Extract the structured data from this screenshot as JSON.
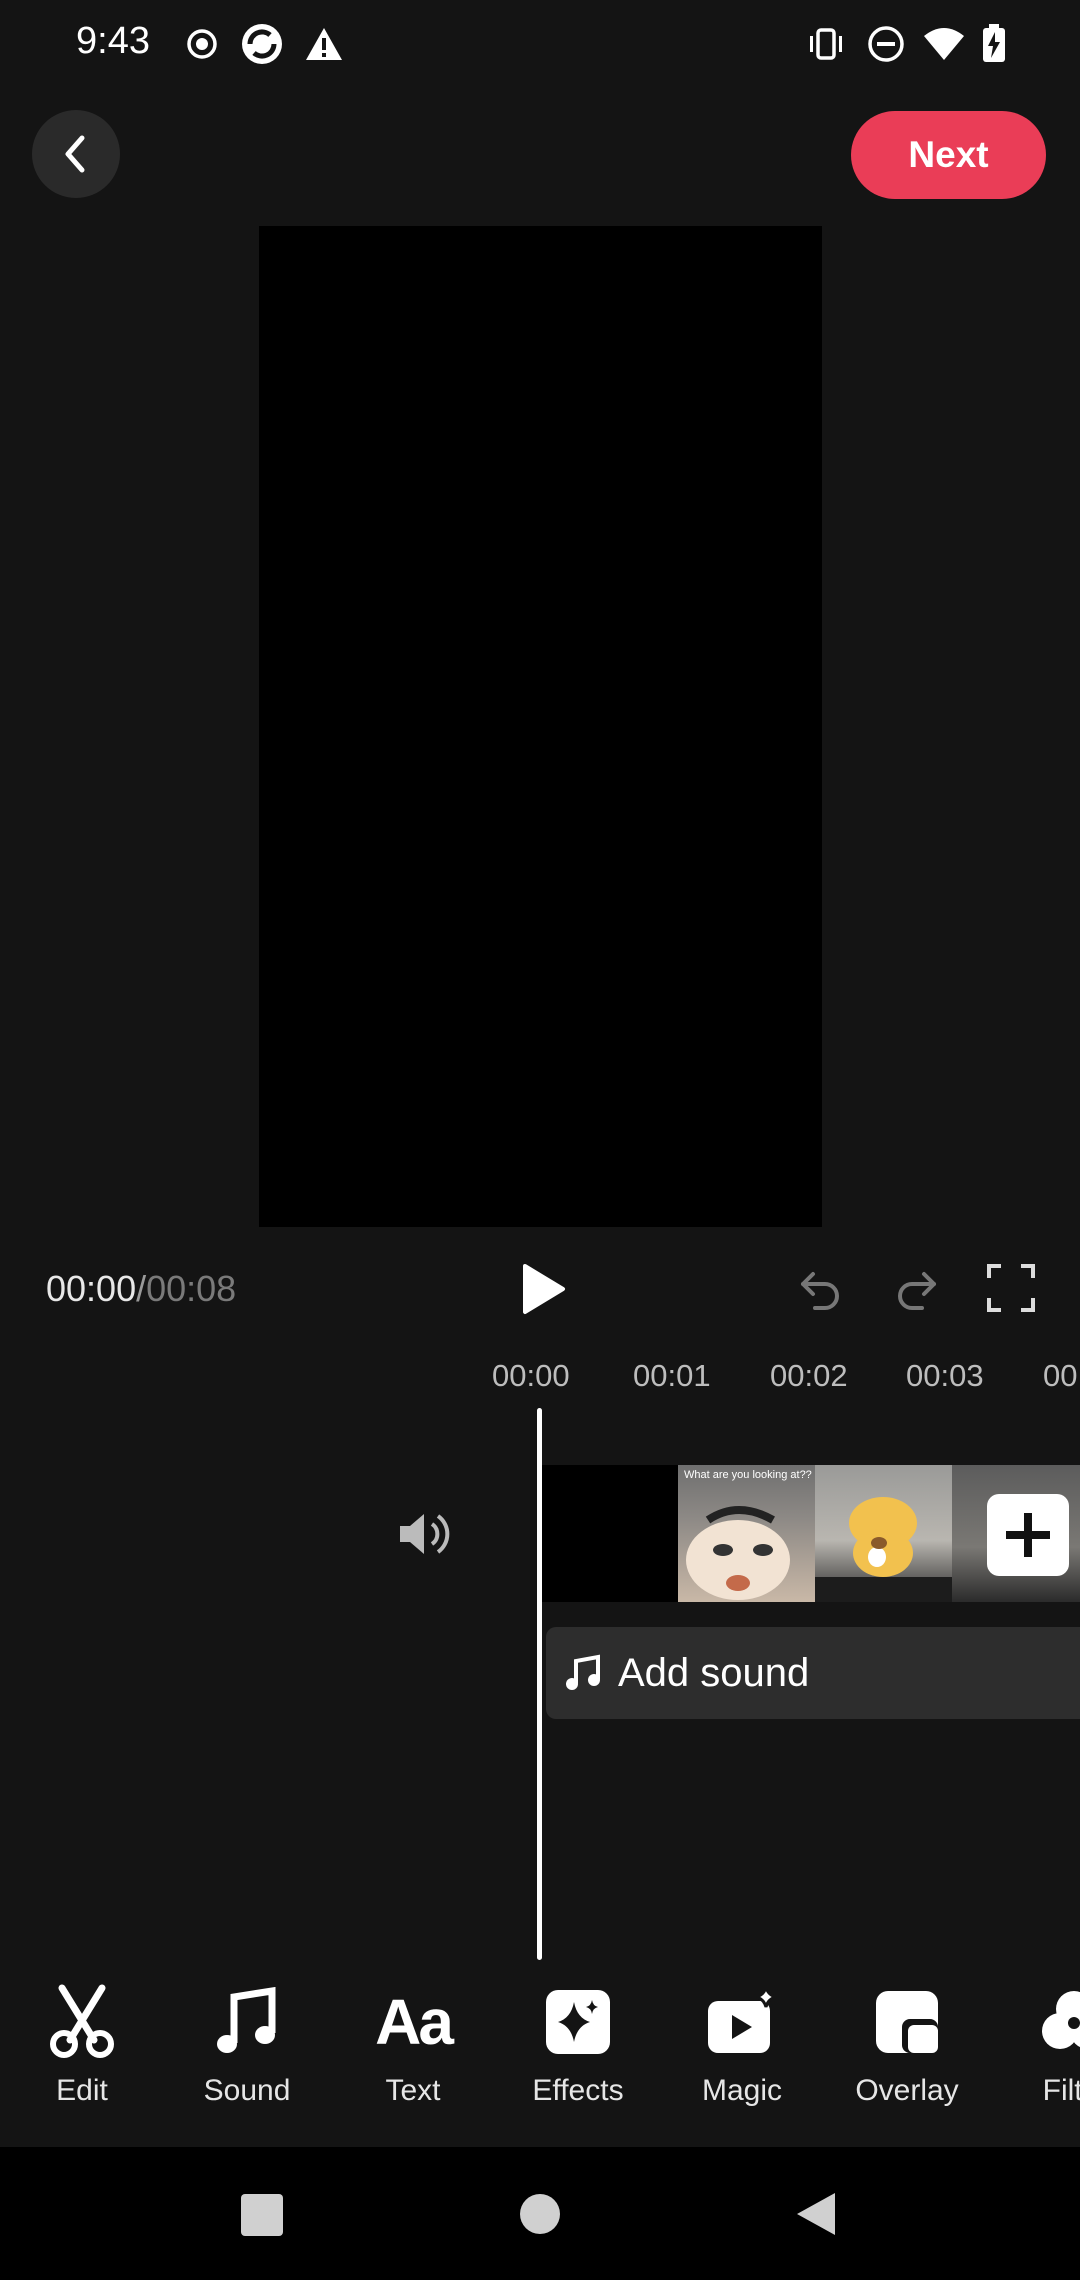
{
  "status_bar": {
    "time": "9:43",
    "left_icons": [
      "record-icon",
      "sync-icon",
      "warning-icon"
    ],
    "right_icons": [
      "vibrate-icon",
      "do-not-disturb-icon",
      "wifi-icon",
      "battery-charging-icon"
    ]
  },
  "top_bar": {
    "next_label": "Next"
  },
  "playback": {
    "current_time": "00:00",
    "separator": "/",
    "total_time": "00:08"
  },
  "timeline": {
    "ruler": [
      "00:00",
      "00:01",
      "00:02",
      "00:03",
      "00"
    ],
    "add_sound_label": "Add sound",
    "thumbnail_caption": "What are you looking at??"
  },
  "toolbar": {
    "items": [
      {
        "label": "Edit",
        "icon": "scissors-icon"
      },
      {
        "label": "Sound",
        "icon": "music-note-icon"
      },
      {
        "label": "Text",
        "icon": "text-aa-icon"
      },
      {
        "label": "Effects",
        "icon": "sparkle-icon"
      },
      {
        "label": "Magic",
        "icon": "magic-video-icon"
      },
      {
        "label": "Overlay",
        "icon": "overlay-icon"
      },
      {
        "label": "Filte",
        "icon": "filter-icon"
      }
    ]
  },
  "colors": {
    "accent": "#ea3d57",
    "background": "#141414"
  }
}
